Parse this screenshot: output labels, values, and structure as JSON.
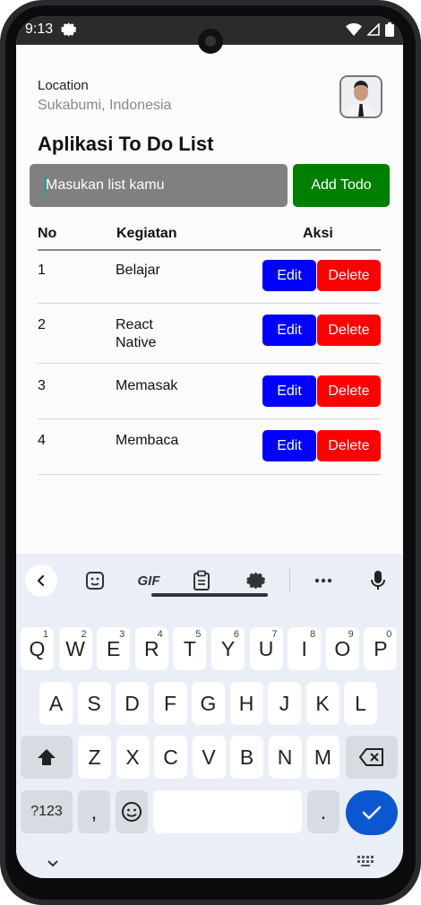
{
  "status": {
    "time": "9:13"
  },
  "header": {
    "location_label": "Location",
    "location_value": "Sukabumi, Indonesia",
    "title": "Aplikasi To Do List"
  },
  "form": {
    "placeholder": "Masukan list kamu",
    "add_label": "Add Todo"
  },
  "table": {
    "headers": {
      "no": "No",
      "kegiatan": "Kegiatan",
      "aksi": "Aksi"
    },
    "rows": [
      {
        "no": "1",
        "kegiatan": "Belajar",
        "edit": "Edit",
        "delete": "Delete"
      },
      {
        "no": "2",
        "kegiatan": "React\nNative",
        "edit": "Edit",
        "delete": "Delete"
      },
      {
        "no": "3",
        "kegiatan": "Memasak",
        "edit": "Edit",
        "delete": "Delete"
      },
      {
        "no": "4",
        "kegiatan": "Membaca",
        "edit": "Edit",
        "delete": "Delete"
      }
    ]
  },
  "keyboard": {
    "toolbar": {
      "gif": "GIF"
    },
    "row1": [
      {
        "letter": "Q",
        "hint": "1"
      },
      {
        "letter": "W",
        "hint": "2"
      },
      {
        "letter": "E",
        "hint": "3"
      },
      {
        "letter": "R",
        "hint": "4"
      },
      {
        "letter": "T",
        "hint": "5"
      },
      {
        "letter": "Y",
        "hint": "6"
      },
      {
        "letter": "U",
        "hint": "7"
      },
      {
        "letter": "I",
        "hint": "8"
      },
      {
        "letter": "O",
        "hint": "9"
      },
      {
        "letter": "P",
        "hint": "0"
      }
    ],
    "row2": [
      "A",
      "S",
      "D",
      "F",
      "G",
      "H",
      "J",
      "K",
      "L"
    ],
    "row3": [
      "Z",
      "X",
      "C",
      "V",
      "B",
      "N",
      "M"
    ],
    "symbols_label": "?123",
    "comma": ",",
    "period": "."
  },
  "colors": {
    "add_button": "#008000",
    "edit_button": "#0000ff",
    "delete_button": "#ff0000",
    "input_bg": "#808080",
    "enter_key": "#0b57d0"
  },
  "icons": [
    "settings-icon",
    "wifi-icon",
    "signal-icon",
    "battery-icon",
    "chevron-left-icon",
    "sticker-icon",
    "clipboard-icon",
    "gear-icon",
    "more-icon",
    "mic-icon",
    "shift-icon",
    "backspace-icon",
    "emoji-icon",
    "check-icon",
    "chevron-down-icon",
    "keyboard-icon"
  ]
}
